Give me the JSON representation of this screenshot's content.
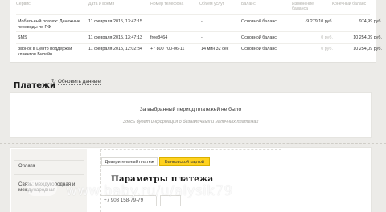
{
  "history_table": {
    "headers": [
      "Сервис",
      "Дата и время",
      "Номер телефона",
      "Объем услуг",
      "Баланс",
      "Изменение баланса",
      "Конечный баланс"
    ],
    "rows": [
      {
        "service": "Мобильный платеж: Денежные переводы по РФ",
        "datetime": "11 февраля 2015, 13:47:15",
        "phone": "",
        "volume": "-",
        "balance": "Основной баланс",
        "change": "-9 279,10 руб.",
        "final": "974,99 руб."
      },
      {
        "service": "SMS",
        "datetime": "11 февраля 2015, 13:47:13",
        "phone": "free8464",
        "volume": "-",
        "balance": "Основной баланс",
        "change": "0 руб.",
        "final": "10 254,09 руб."
      },
      {
        "service": "Звонок в Центр поддержки клиентов Билайн",
        "datetime": "11 февраля 2015, 12:02:34",
        "phone": "+7 800 700-06-11",
        "volume": "14 мин 32 сек",
        "balance": "Основной баланс",
        "change": "0 руб.",
        "final": "10 254,09 руб."
      }
    ]
  },
  "payments": {
    "title": "Платежи",
    "refresh_label": "Обновить данные",
    "empty_title": "За выбранный период платежей не было",
    "empty_subtitle": "Здесь будет информация о безналичных и наличных платежах"
  },
  "payment_form": {
    "sidebar": [
      "Оплата",
      "Связь: междугородная и международная"
    ],
    "tabs": [
      {
        "label": "Доверительный платеж",
        "active": false
      },
      {
        "label": "Банковской картой",
        "active": true
      }
    ],
    "params_title": "Параметры платежа",
    "phone_value": "+7 903 158-79-79"
  },
  "watermark": "www.baby.ru/u/alysik79",
  "colors": {
    "accent": "#ffd21f",
    "background": "#ecebe8"
  }
}
